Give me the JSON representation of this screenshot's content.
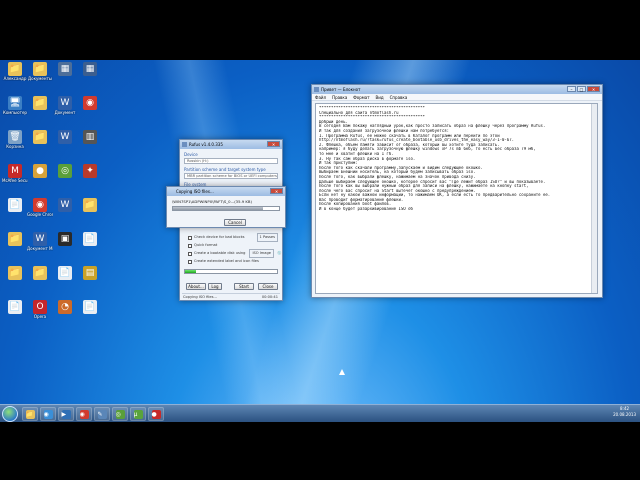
{
  "desktop": {
    "icons": [
      {
        "label": "Александр",
        "glyph": "📁",
        "color": "#e8c25a"
      },
      {
        "label": "Компьютер",
        "glyph": "🖥",
        "color": "#3c7fc4"
      },
      {
        "label": "Корзина",
        "glyph": "🗑",
        "color": "#7ea2c6"
      },
      {
        "label": "McAfee Security",
        "glyph": "M",
        "color": "#c62a2a"
      },
      {
        "label": "",
        "glyph": "📄",
        "color": "#e9edf2"
      },
      {
        "label": "",
        "glyph": "📁",
        "color": "#e8c25a"
      },
      {
        "label": "",
        "glyph": "📁",
        "color": "#e8c25a"
      },
      {
        "label": "",
        "glyph": "📄",
        "color": "#e9edf2"
      },
      {
        "label": "Документы",
        "glyph": "📁",
        "color": "#e8c25a"
      },
      {
        "label": "",
        "glyph": "📁",
        "color": "#e8c25a"
      },
      {
        "label": "",
        "glyph": "📁",
        "color": "#e8c25a"
      },
      {
        "label": "",
        "glyph": "●",
        "color": "#d7a23a"
      },
      {
        "label": "Google Chrome",
        "glyph": "◉",
        "color": "#d13b2e"
      },
      {
        "label": "Документ Microsoft",
        "glyph": "W",
        "color": "#2f5fa8"
      },
      {
        "label": "",
        "glyph": "📁",
        "color": "#e8c25a"
      },
      {
        "label": "Opera",
        "glyph": "O",
        "color": "#c4262b"
      },
      {
        "label": "",
        "glyph": "▦",
        "color": "#4d6e99"
      },
      {
        "label": "Документ",
        "glyph": "W",
        "color": "#2f5fa8"
      },
      {
        "label": "",
        "glyph": "W",
        "color": "#2f5fa8"
      },
      {
        "label": "",
        "glyph": "◎",
        "color": "#5a9f3a"
      },
      {
        "label": "",
        "glyph": "W",
        "color": "#2f5fa8"
      },
      {
        "label": "",
        "glyph": "▣",
        "color": "#2a2a2a"
      },
      {
        "label": "",
        "glyph": "📄",
        "color": "#e9edf2"
      },
      {
        "label": "",
        "glyph": "◔",
        "color": "#cc6a2a"
      },
      {
        "label": "",
        "glyph": "▦",
        "color": "#3b5e8f"
      },
      {
        "label": "",
        "glyph": "◉",
        "color": "#d13b2e"
      },
      {
        "label": "",
        "glyph": "▥",
        "color": "#555"
      },
      {
        "label": "",
        "glyph": "✦",
        "color": "#b83a2a"
      },
      {
        "label": "",
        "glyph": "📁",
        "color": "#e8c25a"
      },
      {
        "label": "",
        "glyph": "📄",
        "color": "#e9edf2"
      },
      {
        "label": "",
        "glyph": "▤",
        "color": "#c9a227"
      },
      {
        "label": "",
        "glyph": "📄",
        "color": "#e9edf2"
      }
    ]
  },
  "rufus": {
    "title": "Rufus v1.4.0.335",
    "device_label": "Device",
    "device_value": "Rosskin (H:)",
    "partition_label": "Partition scheme and target system type",
    "partition_value": "MBR partition scheme for BIOS or UEFI computers",
    "fs_label": "File system",
    "opt_bad": "Check device for bad blocks",
    "opt_bad_passes": "1 Passes",
    "opt_quick": "Quick format",
    "opt_boot": "Create a bootable disk using",
    "opt_boot_value": "ISO Image",
    "opt_ext": "Create extended label and icon files",
    "about": "About...",
    "log": "Log",
    "start": "Start",
    "close": "Close",
    "status": "Copying ISO files...",
    "time": "00:00:41",
    "progress": 0.12
  },
  "copy_dialog": {
    "title": "Copying ISO files...",
    "file": "\\WIN7SP1\\ADPWINPX\\PAFT\\S_0...(35.9 KB)",
    "cancel": "Cancel",
    "progress": 0.85
  },
  "notepad": {
    "title": "Привет — Блокнот",
    "menu": [
      "Файл",
      "Правка",
      "Формат",
      "Вид",
      "Справка"
    ],
    "lines": [
      "********************************************",
      "Специально для сайта ntmoflash.ru",
      "********************************************",
      "Добрый день.",
      "В сегодня Вам покажу наглядный урок,как просто записать образ на флешку через программу Rufus.",
      "И так для создания загрузочной флешки нам потребуется:",
      "1. Программа Rufus, её можно скачать в Каталог программ или перейти по этой",
      "http://ntmoflash.ru/?task=rufus_create_bootable_usb_drives_the_easy_way/3-1-0-67.",
      "2. Флешка, объем памяти зависит от образа, который вы хотите туда записать.",
      "например: я буду делать загрузочную флешку windows xP 7s mb 6кб, то есть вес образа 79 мб,",
      "то мне и хватит флешки на 1 гб.",
      "3. Ну так сам образ диска в формате iso.",
      "И так приступим:",
      "После того как скачали программу,запускаем и видим следующее окошко.",
      "Выбираем внешний носитель, на который будем записывать образ iso.",
      "После того, как выбрали флешку, нажимаем на значок привода снизу.",
      "Дальше выбираем следующее окошко, которое спросит вас \"Где лежит образ ISO?\" и вы показываете.",
      "После того как вы выбрали нужный образ для записи на флешку, нажимаете на кнопку start,",
      "после чего вас спросит на Start вытечет окошко с предупреждением.",
      "Если нет ну какой важной информации, то нажимаем ОК, а если есть то предварительно сохраните ее.",
      "Вас проводит форматирование флешки.",
      "После копирования boot файлов.",
      "И в конце будет разархивирование ISO об"
    ]
  },
  "taskbar": {
    "apps": [
      {
        "glyph": "📁",
        "color": "#e8c25a"
      },
      {
        "glyph": "◉",
        "color": "#3a8fd8"
      },
      {
        "glyph": "▶",
        "color": "#2f6fb5"
      },
      {
        "glyph": "◉",
        "color": "#d13b2e"
      },
      {
        "glyph": "✎",
        "color": "#5a86b8"
      },
      {
        "glyph": "◎",
        "color": "#5a9f3a"
      },
      {
        "glyph": "µ",
        "color": "#5aa33c"
      },
      {
        "glyph": "●",
        "color": "#c62a2a"
      }
    ],
    "time": "8:42",
    "date": "20.08.2013"
  }
}
